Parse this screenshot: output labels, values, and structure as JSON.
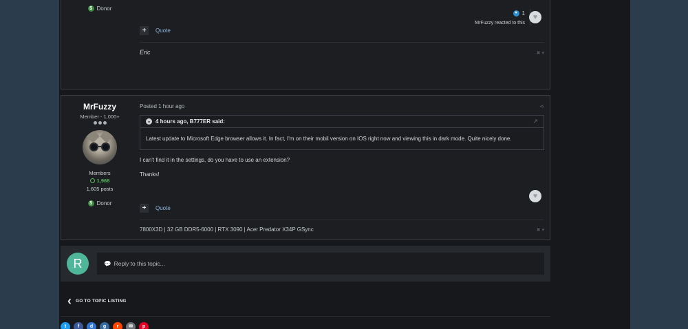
{
  "post1": {
    "donor_label": "Donor",
    "quote_label": "Quote",
    "reaction_count": "1",
    "reaction_text": "MrFuzzy reacted to this",
    "signature": "Eric"
  },
  "post2": {
    "author_name": "MrFuzzy",
    "author_title": "Member - 1,000+",
    "group": "Members",
    "reputation": "1,968",
    "post_count": "1,605 posts",
    "donor_label": "Donor",
    "posted_time": "Posted 1 hour ago",
    "quote": {
      "author": "4 hours ago, B777ER said:",
      "body": "Latest update to Microsoft Edge browser allows it. In fact, I'm on their mobil version on IOS right now and viewing this in dark mode. Quite nicely done."
    },
    "paragraphs": [
      "I can't find it in the settings, do you have to use an extension?",
      "Thanks!"
    ],
    "quote_label": "Quote",
    "signature": "7800X3D | 32 GB DDR5-6000 | RTX 3090 | Acer Predator X34P GSync"
  },
  "reply": {
    "avatar_letter": "R",
    "placeholder": "Reply to this topic..."
  },
  "back_link": "GO TO TOPIC LISTING",
  "social_icons": [
    {
      "name": "twitter-icon",
      "color": "#1d9bf0",
      "glyph": "t"
    },
    {
      "name": "facebook-icon",
      "color": "#3b5998",
      "glyph": "f"
    },
    {
      "name": "delicious-icon",
      "color": "#3274d1",
      "glyph": "d"
    },
    {
      "name": "digg-icon",
      "color": "#356aa0",
      "glyph": "g"
    },
    {
      "name": "reddit-icon",
      "color": "#ff4500",
      "glyph": "r"
    },
    {
      "name": "email-icon",
      "color": "#6d7278",
      "glyph": "✉"
    },
    {
      "name": "pinterest-icon",
      "color": "#e60023",
      "glyph": "p"
    }
  ]
}
